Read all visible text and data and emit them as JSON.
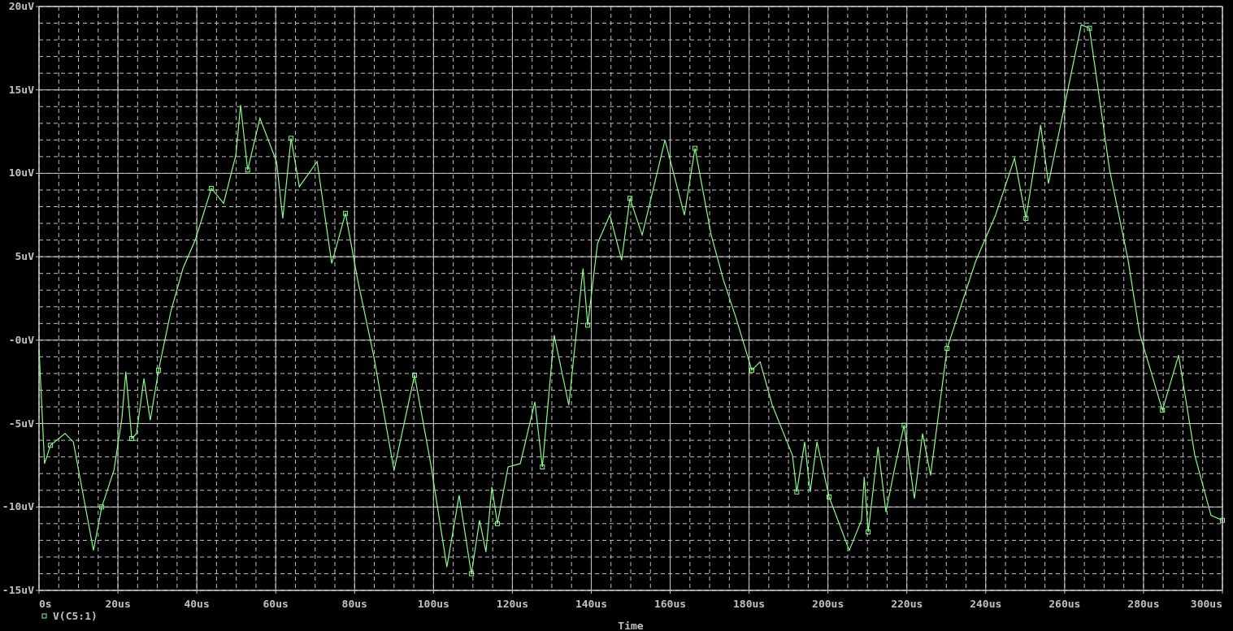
{
  "plot": {
    "chart_data": {
      "type": "line",
      "grid": true,
      "xlabel": "Time",
      "xlim": [
        0,
        300
      ],
      "ylim": [
        -15,
        20
      ],
      "xticks": [
        {
          "value": 0,
          "label": "0s"
        },
        {
          "value": 20,
          "label": "20us"
        },
        {
          "value": 40,
          "label": "40us"
        },
        {
          "value": 60,
          "label": "60us"
        },
        {
          "value": 80,
          "label": "80us"
        },
        {
          "value": 100,
          "label": "100us"
        },
        {
          "value": 120,
          "label": "120us"
        },
        {
          "value": 140,
          "label": "140us"
        },
        {
          "value": 160,
          "label": "160us"
        },
        {
          "value": 180,
          "label": "180us"
        },
        {
          "value": 200,
          "label": "200us"
        },
        {
          "value": 220,
          "label": "220us"
        },
        {
          "value": 240,
          "label": "240us"
        },
        {
          "value": 260,
          "label": "260us"
        },
        {
          "value": 280,
          "label": "280us"
        },
        {
          "value": 300,
          "label": "300us"
        }
      ],
      "yticks": [
        {
          "value": -15,
          "label": "-15uV"
        },
        {
          "value": -10,
          "label": "-10uV"
        },
        {
          "value": -5,
          "label": "-5uV"
        },
        {
          "value": 0,
          "label": "-0uV"
        },
        {
          "value": 5,
          "label": "5uV"
        },
        {
          "value": 10,
          "label": "10uV"
        },
        {
          "value": 15,
          "label": "15uV"
        },
        {
          "value": 20,
          "label": "20uV"
        }
      ],
      "x": [
        0,
        1.4,
        2.9,
        6.6,
        8.7,
        13.8,
        15.9,
        19,
        21,
        22,
        23.5,
        24.7,
        26.6,
        28.2,
        30.3,
        33.4,
        36.5,
        39.6,
        43.7,
        46.8,
        49.9,
        51.1,
        52.9,
        56,
        60.2,
        61.8,
        63.9,
        66,
        70.5,
        74.2,
        77.7,
        80.8,
        84.9,
        90,
        95.2,
        99.3,
        103.4,
        106.5,
        109.6,
        111.7,
        113.3,
        114.8,
        116.2,
        118.9,
        122,
        125.7,
        127.6,
        130.6,
        134.3,
        137.9,
        139.1,
        141.6,
        144.7,
        147.7,
        149.8,
        152.9,
        158.7,
        163.6,
        166.3,
        170.4,
        173.5,
        176.6,
        180.7,
        182.8,
        185.9,
        191,
        192.1,
        194.1,
        195.5,
        197.2,
        200.3,
        205.4,
        208.5,
        209.2,
        210.2,
        212.7,
        214.7,
        216.8,
        219.3,
        221.9,
        224,
        226,
        230.2,
        237.4,
        242.5,
        247.3,
        250.2,
        253.9,
        255.9,
        264.2,
        266.3,
        271.4,
        276.1,
        279,
        284.8,
        288.9,
        293,
        297.1,
        300
      ],
      "series": [
        {
          "name": "V(C5:1)",
          "color": "#80ff80",
          "values": [
            -0.5,
            -7.4,
            -6.3,
            -5.6,
            -6.1,
            -12.6,
            -10.0,
            -7.8,
            -4.7,
            -1.9,
            -5.9,
            -5.6,
            -2.3,
            -4.8,
            -1.8,
            1.7,
            4.3,
            6.0,
            9.1,
            8.2,
            11.1,
            14.1,
            10.2,
            13.3,
            10.7,
            7.3,
            12.1,
            9.2,
            10.7,
            4.6,
            7.6,
            3.6,
            -1.0,
            -7.8,
            -2.1,
            -7.4,
            -13.6,
            -9.3,
            -14.0,
            -10.8,
            -12.7,
            -8.8,
            -11.0,
            -7.6,
            -7.4,
            -3.7,
            -7.6,
            0.3,
            -3.9,
            4.3,
            0.9,
            5.8,
            7.5,
            4.8,
            8.5,
            6.3,
            12.0,
            7.5,
            11.5,
            6.3,
            3.6,
            1.4,
            -1.8,
            -1.3,
            -3.9,
            -6.9,
            -9.1,
            -6.1,
            -9.1,
            -6.1,
            -9.4,
            -12.6,
            -10.8,
            -8.2,
            -11.5,
            -6.4,
            -10.3,
            -7.8,
            -5.1,
            -9.5,
            -5.6,
            -8.1,
            -0.5,
            4.7,
            7.5,
            10.9,
            7.3,
            12.9,
            9.4,
            18.9,
            18.7,
            10.2,
            4.8,
            0.4,
            -4.2,
            -0.9,
            -6.9,
            -10.5,
            -10.8
          ]
        }
      ]
    }
  }
}
